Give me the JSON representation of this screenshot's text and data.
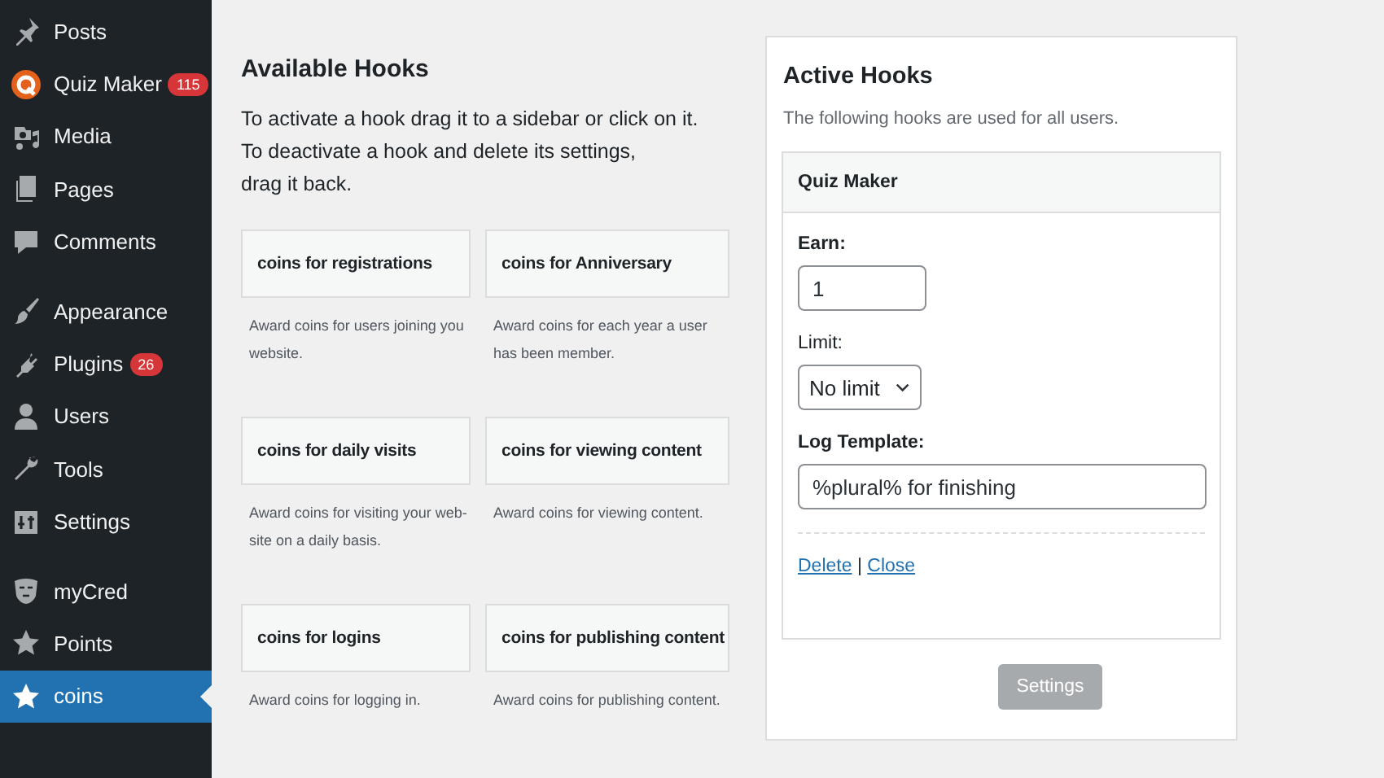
{
  "sidebar": {
    "groups": [
      [
        {
          "label": "Posts",
          "selected": false
        },
        {
          "label": "Quiz Maker",
          "badge": "115",
          "selected": false
        },
        {
          "label": "Media",
          "selected": false
        },
        {
          "label": "Pages",
          "selected": false
        },
        {
          "label": "Comments",
          "selected": false
        }
      ],
      [
        {
          "label": "Appearance",
          "selected": false
        },
        {
          "label": "Plugins",
          "badge": "26",
          "selected": false
        },
        {
          "label": "Users",
          "selected": false
        },
        {
          "label": "Tools",
          "selected": false
        },
        {
          "label": "Settings",
          "selected": false
        }
      ],
      [
        {
          "label": "myCred",
          "selected": false
        },
        {
          "label": "Points",
          "selected": false
        },
        {
          "label": "coins",
          "selected": true
        }
      ]
    ]
  },
  "available_hooks": {
    "title": "Available Hooks",
    "intro": [
      "To activate a hook drag it to a sidebar or click on it.",
      "To deactivate a hook and delete its settings,",
      "drag it back."
    ],
    "hooks": [
      {
        "title": "coins for registrations",
        "description": "Award coins for users joining you website."
      },
      {
        "title": "coins for Anniversary",
        "description": "Award coins for each year a user has been member."
      },
      {
        "title": "coins for daily visits",
        "description": "Award coins for visiting your web-site on a daily basis."
      },
      {
        "title": "coins for viewing content",
        "description": "Award coins for viewing content."
      },
      {
        "title": "coins for logins",
        "description": "Award coins for logging in."
      },
      {
        "title": "coins for publishing content",
        "description": "Award coins for publishing content."
      }
    ]
  },
  "active_hooks": {
    "title": "Active Hooks",
    "subtitle": "The following hooks are used for all users.",
    "widget": {
      "title": "Quiz Maker",
      "earn_label": "Earn:",
      "earn_value": "1",
      "limit_label": "Limit:",
      "limit_value": "No limit",
      "log_label": "Log Template:",
      "log_value": "%plural% for finishing",
      "links": [
        "Delete",
        "Close"
      ],
      "separator": "|"
    },
    "settings_button": {
      "label": "Settings",
      "disabled": true
    }
  }
}
